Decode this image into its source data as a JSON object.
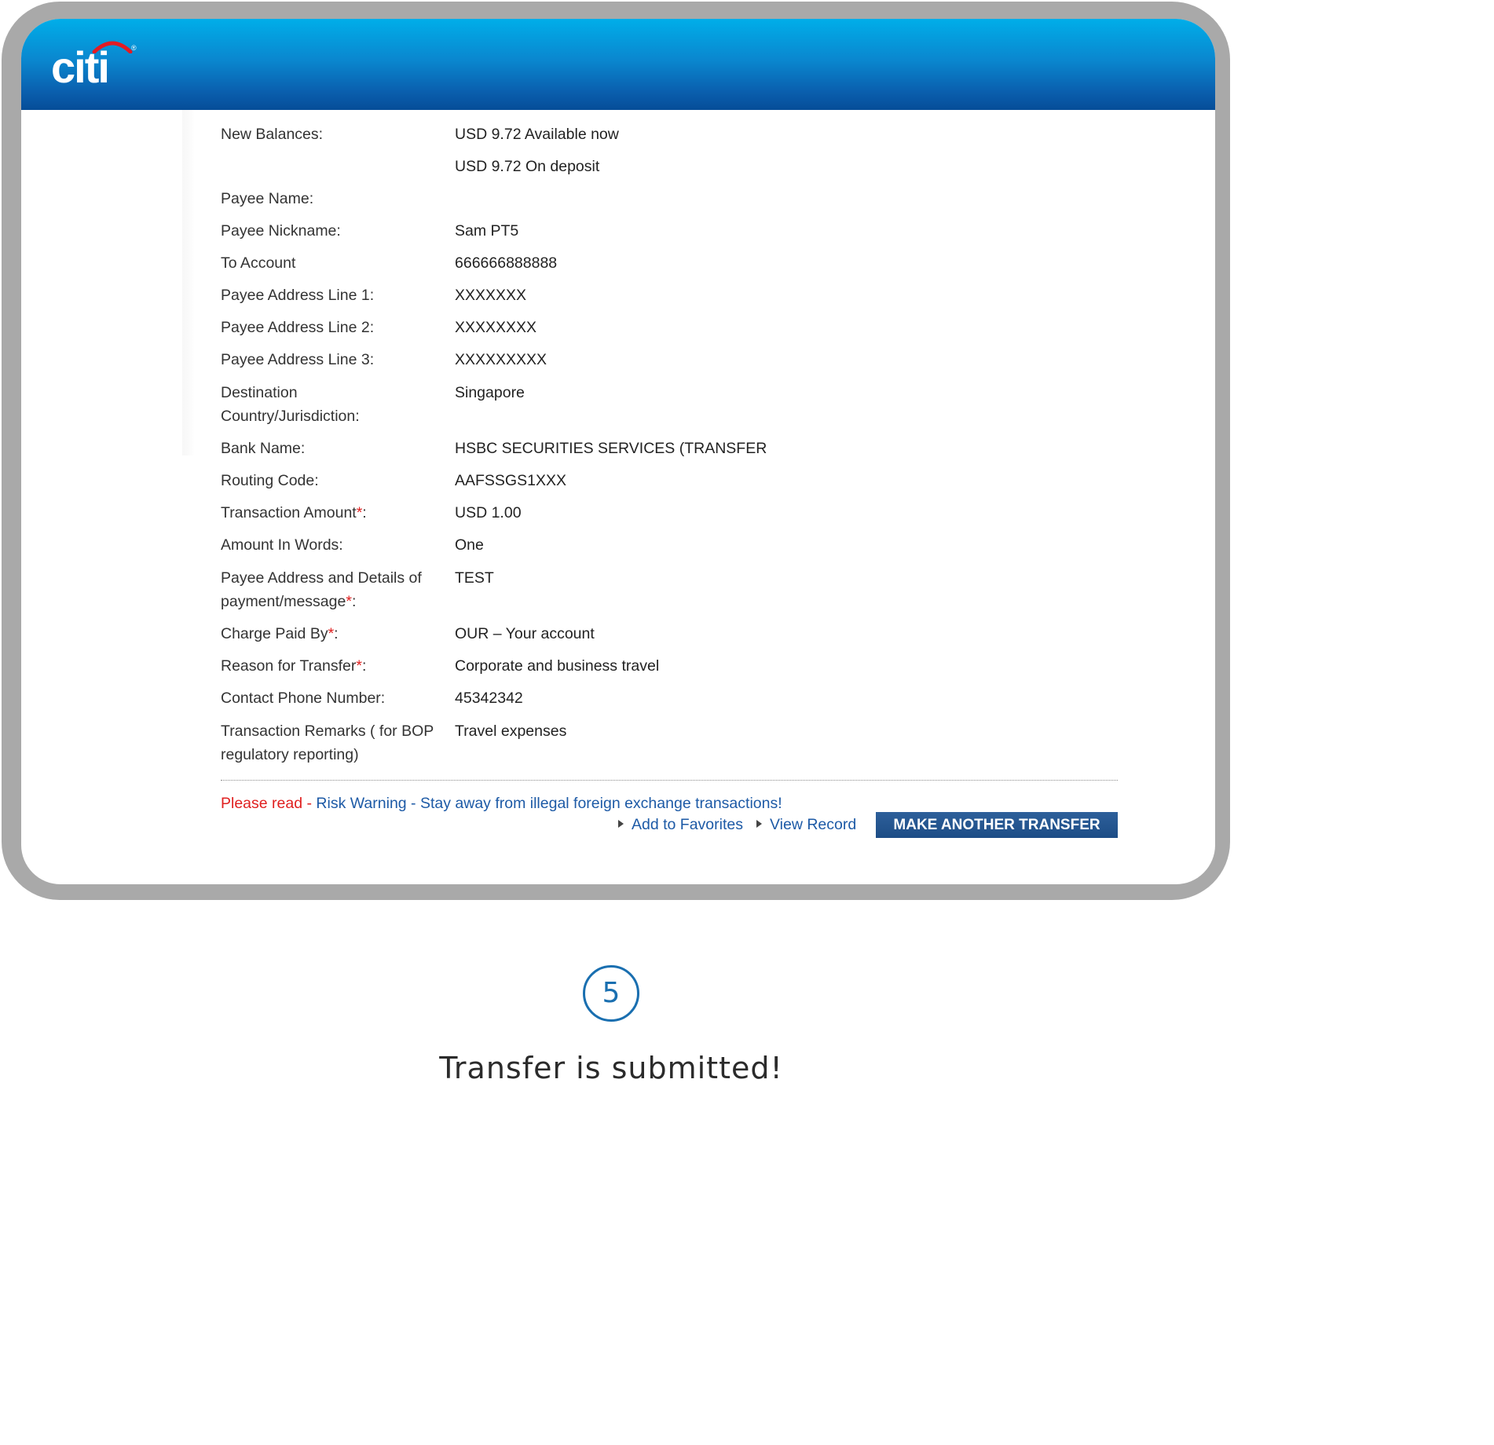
{
  "brand": {
    "logo_text": "citi",
    "logo_reg": "®"
  },
  "details": [
    {
      "label": "New Balances:",
      "values": [
        "USD 9.72 Available now",
        "USD 9.72 On deposit"
      ]
    },
    {
      "label": "Payee Name:",
      "values": [
        ""
      ]
    },
    {
      "label": "Payee Nickname:",
      "values": [
        "Sam PT5"
      ]
    },
    {
      "label": "To Account",
      "values": [
        "666666888888"
      ]
    },
    {
      "label": "Payee Address Line 1:",
      "values": [
        "XXXXXXX"
      ]
    },
    {
      "label": "Payee Address Line 2:",
      "values": [
        "XXXXXXXX"
      ]
    },
    {
      "label": "Payee Address Line 3:",
      "values": [
        "XXXXXXXXX"
      ]
    },
    {
      "label": "Destination Country/Jurisdiction:",
      "values": [
        "Singapore"
      ]
    },
    {
      "label": "Bank Name:",
      "values": [
        "HSBC SECURITIES SERVICES (TRANSFER"
      ]
    },
    {
      "label": "Routing Code:",
      "values": [
        "AAFSSGS1XXX"
      ]
    },
    {
      "label": "Transaction Amount",
      "required": true,
      "values": [
        "USD 1.00"
      ]
    },
    {
      "label": "Amount In Words:",
      "values": [
        "One"
      ]
    },
    {
      "label": "Payee Address and Details of payment/message",
      "required": true,
      "values": [
        "TEST"
      ]
    },
    {
      "label": "Charge Paid By",
      "required": true,
      "values": [
        "OUR – Your account"
      ]
    },
    {
      "label": "Reason for Transfer",
      "required": true,
      "values": [
        "Corporate and business travel"
      ]
    },
    {
      "label": "Contact Phone Number:",
      "values": [
        "45342342"
      ]
    },
    {
      "label": "Transaction Remarks ( for BOP regulatory reporting)",
      "values": [
        "Travel expenses"
      ]
    }
  ],
  "required_marker": "*",
  "warning": {
    "please_read": "Please read",
    "separator": " - ",
    "risk_warning": "Risk Warning - Stay away from illegal foreign exchange transactions!"
  },
  "actions": {
    "add_to_favorites": "Add to Favorites",
    "view_record": "View Record",
    "make_another_transfer": "MAKE ANOTHER TRANSFER"
  },
  "step": {
    "number": "5",
    "caption": "Transfer is submitted!"
  },
  "colors": {
    "header_top": "#00aee9",
    "header_bottom": "#064d98",
    "link": "#1d5aa6",
    "required": "#e02020",
    "step": "#1a6fb0"
  }
}
